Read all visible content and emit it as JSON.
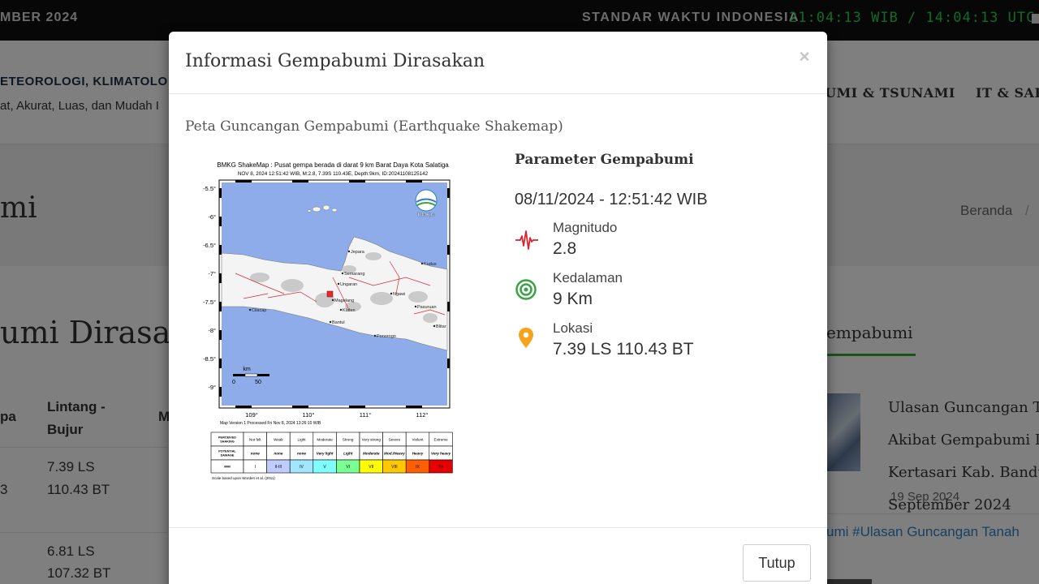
{
  "topbar": {
    "date_fragment": "MBER 2024",
    "time_label": "STANDAR WAKTU INDONESIA",
    "clock": "21:04:13 WIB / 14:04:13 UTC"
  },
  "header": {
    "org_fragment": "ETEOROLOGI, KLIMATOLO",
    "tagline_fragment": "at, Akurat, Luas, dan Mudah I",
    "nav_items": [
      "UMI & TSUNAMI",
      "IT & SAR"
    ]
  },
  "titlebar": {
    "title_fragment": "mi",
    "breadcrumb_home": "Beranda",
    "breadcrumb_sep": "/"
  },
  "content": {
    "heading_fragment": "umi Dirasak",
    "table_headers": [
      "pa",
      "Lintang -\nBujur",
      "M"
    ],
    "rows": [
      {
        "left_fragment": "3",
        "lat": "7.39 LS",
        "lon": "110.43 BT"
      },
      {
        "left_fragment": "",
        "lat": "6.81 LS",
        "lon": "107.32 BT"
      }
    ],
    "sidebar_title_fragment": "empabumi",
    "news_lines": [
      "Ulasan Guncangan T",
      "Akibat Gempabumi D",
      "Kertasari Kab. Bandu",
      "September 2024"
    ],
    "news_date": "19 Sep 2024",
    "tags_fragment": "umi #Ulasan Guncangan Tanah"
  },
  "modal": {
    "title": "Informasi Gempabumi Dirasakan",
    "close_label": "×",
    "subtitle": "Peta Guncangan Gempabumi (Earthquake Shakemap)",
    "shakemap": {
      "title_line1": "BMKG ShakeMap : Pusat gempa berada di darat 9 km Barat Daya Kota Salatiga",
      "title_line2": "NOV 8, 2024 12:51:42 WIB, M:2.8, 7.39S 110.43E, Depth:9km, ID:20241108125142",
      "lat_ticks": [
        "-5.5°",
        "-6°",
        "-6.5°",
        "-7°",
        "-7.5°",
        "-8°",
        "-8.5°",
        "-9°"
      ],
      "lon_ticks": [
        "109°",
        "110°",
        "111°",
        "112°"
      ],
      "logo_text": "BMKG",
      "scale_label": "km",
      "scale_ticks": [
        "0",
        "50"
      ],
      "version_text": "Map Version 1 Processed Fri Nov  8, 2024 13:26:10 WIB",
      "cities": [
        "Jepara",
        "Semarang",
        "Kudus",
        "Ungaran",
        "Magelang",
        "Klaten",
        "Bantul",
        "Ngawi",
        "Pasuruan",
        "Cilacap",
        "Blitar",
        "Ponorogo"
      ],
      "legend": {
        "row_labels": [
          "PERCEIVED SHAKING",
          "POTENTIAL DAMAGE",
          "MMI"
        ],
        "shaking": [
          "Not felt",
          "Weak",
          "Light",
          "Moderate",
          "Strong",
          "Very strong",
          "Severe",
          "Violent",
          "Extreme"
        ],
        "damage": [
          "none",
          "none",
          "none",
          "Very light",
          "Light",
          "Moderate",
          "Mod./Heavy",
          "Heavy",
          "Very heavy"
        ],
        "mmi": [
          "I",
          "II-III",
          "IV",
          "V",
          "VI",
          "VII",
          "VIII",
          "IX",
          "X+"
        ],
        "colors": [
          "#ffffff",
          "#bfccff",
          "#a0e6ff",
          "#80ffff",
          "#7aff93",
          "#ffff00",
          "#ffc800",
          "#ff5f00",
          "#e60000"
        ],
        "footnote": "Scale based upon Worden et al. (2011)"
      }
    },
    "params": {
      "title": "Parameter Gempabumi",
      "datetime": "08/11/2024 - 12:51:42 WIB",
      "items": [
        {
          "label": "Magnitudo",
          "value": "2.8",
          "icon": "seismograph-icon",
          "color": "#d9242c"
        },
        {
          "label": "Kedalaman",
          "value": "9 Km",
          "icon": "depth-target-icon",
          "color": "#3ba244"
        },
        {
          "label": "Lokasi",
          "value": "7.39 LS 110.43 BT",
          "icon": "location-pin-icon",
          "color": "#f5a31a"
        }
      ]
    },
    "close_button_label": "Tutup"
  }
}
